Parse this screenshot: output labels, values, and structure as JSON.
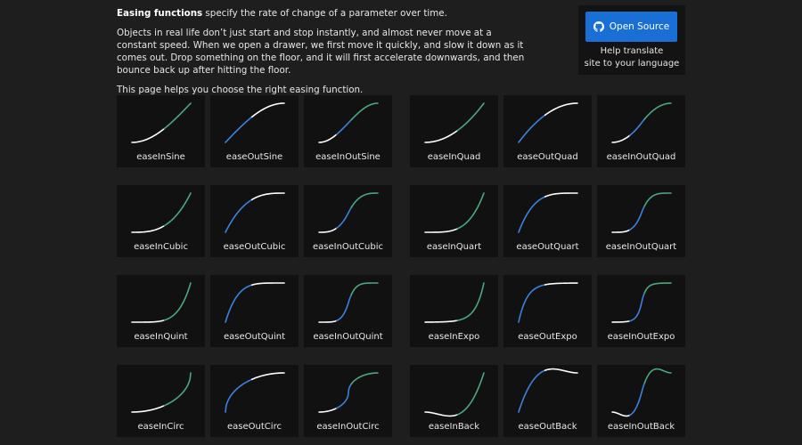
{
  "intro": {
    "lead_bold": "Easing functions",
    "lead_rest": " specify the rate of change of a parameter over time.",
    "paragraph": "Objects in real life don’t just start and stop instantly, and almost never move at a constant speed. When we open a drawer, we first move it quickly, and slow it down as it comes out. Drop something on the floor, and it will first accelerate downwards, and then bounce back up after hitting the floor.",
    "helper": "This page helps you choose the right easing function."
  },
  "promo": {
    "button_label": "Open Source",
    "button_icon": "github-icon",
    "translate_line1": "Help translate",
    "translate_line2": "site to your language"
  },
  "colors": {
    "background": "#1e1e1e",
    "card": "#111111",
    "curve_in": "#4aa87f",
    "curve_out": "#3b82e0",
    "curve_main": "#ffffff",
    "button": "#1a6fd6"
  },
  "easings": [
    {
      "label": "easeInSine",
      "kind": "in"
    },
    {
      "label": "easeOutSine",
      "kind": "out"
    },
    {
      "label": "easeInOutSine",
      "kind": "inout"
    },
    {
      "label": "easeInQuad",
      "kind": "in"
    },
    {
      "label": "easeOutQuad",
      "kind": "out"
    },
    {
      "label": "easeInOutQuad",
      "kind": "inout"
    },
    {
      "label": "easeInCubic",
      "kind": "in"
    },
    {
      "label": "easeOutCubic",
      "kind": "out"
    },
    {
      "label": "easeInOutCubic",
      "kind": "inout"
    },
    {
      "label": "easeInQuart",
      "kind": "in"
    },
    {
      "label": "easeOutQuart",
      "kind": "out"
    },
    {
      "label": "easeInOutQuart",
      "kind": "inout"
    },
    {
      "label": "easeInQuint",
      "kind": "in"
    },
    {
      "label": "easeOutQuint",
      "kind": "out"
    },
    {
      "label": "easeInOutQuint",
      "kind": "inout"
    },
    {
      "label": "easeInExpo",
      "kind": "in"
    },
    {
      "label": "easeOutExpo",
      "kind": "out"
    },
    {
      "label": "easeInOutExpo",
      "kind": "inout"
    },
    {
      "label": "easeInCirc",
      "kind": "in"
    },
    {
      "label": "easeOutCirc",
      "kind": "out"
    },
    {
      "label": "easeInOutCirc",
      "kind": "inout"
    },
    {
      "label": "easeInBack",
      "kind": "in"
    },
    {
      "label": "easeOutBack",
      "kind": "out"
    },
    {
      "label": "easeInOutBack",
      "kind": "inout"
    }
  ]
}
